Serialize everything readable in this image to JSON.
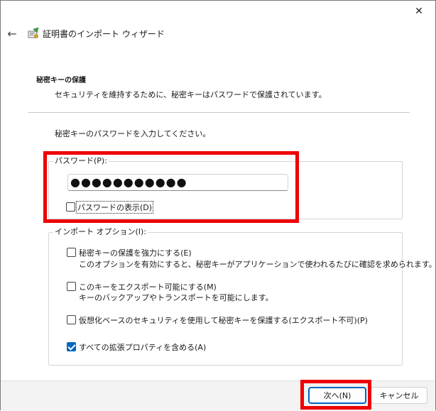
{
  "window": {
    "title": "証明書のインポート ウィザード",
    "close_glyph": "✕",
    "back_glyph": "←"
  },
  "page": {
    "heading": "秘密キーの保護",
    "description": "セキュリティを維持するために、秘密キーはパスワードで保護されています。",
    "prompt": "秘密キーのパスワードを入力してください。"
  },
  "password_group": {
    "legend": "パスワード(P):",
    "input_value": "●●●●●●●●●●●",
    "show_password": {
      "label": "パスワードの表示(D)",
      "checked": false
    }
  },
  "options_group": {
    "legend": "インポート オプション(I):",
    "options": [
      {
        "label": "秘密キーの保護を強力にする(E)",
        "sub": "このオプションを有効にすると、秘密キーがアプリケーションで使われるたびに確認を求められます。",
        "checked": false
      },
      {
        "label": "このキーをエクスポート可能にする(M)",
        "sub": "キーのバックアップやトランスポートを可能にします。",
        "checked": false
      },
      {
        "label": "仮想化ベースのセキュリティを使用して秘密キーを保護する(エクスポート不可)(P)",
        "sub": "",
        "checked": false
      },
      {
        "label": "すべての拡張プロパティを含める(A)",
        "sub": "",
        "checked": true
      }
    ]
  },
  "buttons": {
    "next": "次へ(N)",
    "cancel": "キャンセル"
  },
  "colors": {
    "accent": "#0067c0",
    "highlight": "#ee0000",
    "footer_bg": "#f3f3f3"
  }
}
